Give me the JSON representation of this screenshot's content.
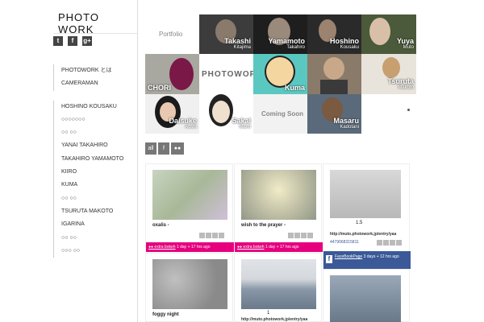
{
  "site": {
    "logo": "PHOTO WORK"
  },
  "social": {
    "twitter": "t",
    "facebook": "f",
    "gplus": "g+"
  },
  "nav": {
    "top": [
      "PHOTOWORK とは",
      "CAMERAMAN"
    ],
    "photographers": [
      "HOSHINO KOUSAKU",
      "○○○○○○○",
      "○○ ○○",
      "YANAI TAKAHIRO",
      "TAKAHIRO YAMAMOTO",
      "KIIRO",
      "KUMA",
      "○○ ○○",
      "TSURUTA MAKOTO",
      "IGARINA",
      "○○ ○○",
      "○○○ ○○"
    ]
  },
  "mosaic": {
    "portfolio": "Portfolio",
    "pw_logo": "PHOTOWORK",
    "coming_soon": "Coming Soon",
    "tiles": [
      {
        "name": "Takashi",
        "sub": "Kitajima"
      },
      {
        "name": "Yamamoto",
        "sub": "Takahiro"
      },
      {
        "name": "Hoshino",
        "sub": "Kousaku"
      },
      {
        "name": "Yuya",
        "sub": "Muto"
      },
      {
        "name": "CHORI",
        "sub": ""
      },
      {
        "name": "Kuma",
        "sub": ""
      },
      {
        "name": "Tsuruta",
        "sub": "Makoto"
      },
      {
        "name": "Daisuke",
        "sub": "Aoshi"
      },
      {
        "name": "Sakai",
        "sub": "Mami"
      },
      {
        "name": "Masaru",
        "sub": "Kadotani"
      }
    ]
  },
  "filters": [
    "all",
    "f",
    "●●"
  ],
  "feed": {
    "cards": [
      {
        "title": "oxalis -",
        "source": "●● extra bokeh",
        "time": "1 day + 17 hrs ago"
      },
      {
        "title": "wish to the prayer -",
        "source": "●● extra bokeh",
        "time": "1 day + 17 hrs ago"
      },
      {
        "title": "1.5",
        "url": "http://muto.photowork.jp/entry/yaa",
        "id": "4479068315811",
        "fb_source": "FaceBookPage",
        "fb_time": "3 days + 12 hrs ago"
      },
      {
        "title": "foggy night"
      },
      {
        "title": "1",
        "url": "http://muto.photowork.jp/entry/yaa"
      }
    ]
  },
  "colors": {
    "flickr_pink": "#e6007e",
    "facebook_blue": "#3b5998",
    "button_gray": "#777777"
  }
}
